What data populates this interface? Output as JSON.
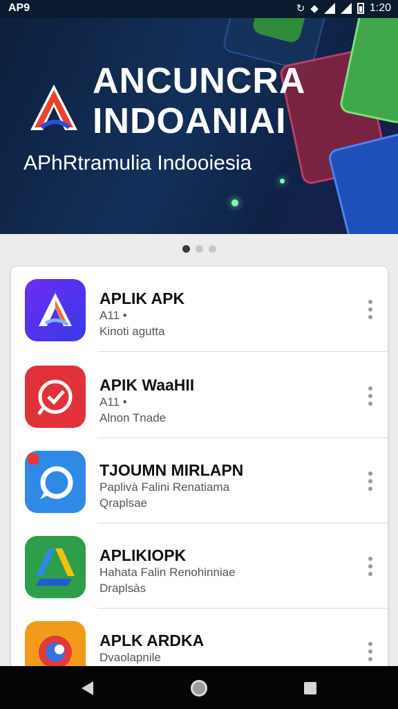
{
  "status_bar": {
    "carrier": "AP9",
    "time": "1:20"
  },
  "banner": {
    "title_line1": "ANCUNCRA",
    "title_line2": "INDOANIAI",
    "subtitle": "APhRtramulia Indooiesia"
  },
  "carousel": {
    "total": 3,
    "active": 1
  },
  "apps": [
    {
      "name": "APLIK APK",
      "line1": "A11 •",
      "line2": "Kinoti agutta",
      "icon": "a-logo-icon",
      "color": "#5a2be0"
    },
    {
      "name": "APIK WaaHII",
      "line1": "A11 •",
      "line2": "Alnon Tnade",
      "icon": "check-badge-icon",
      "color": "#e0343c"
    },
    {
      "name": "TJOUMN MIRLAPN",
      "line1": "Paplivà Falini Renatiama",
      "line2": "Qraplsae",
      "icon": "chat-ring-icon",
      "color": "#2f8ae6"
    },
    {
      "name": "APLIKIOPK",
      "line1": "Hahata Falin Renohinniae",
      "line2": "Draplsàs",
      "icon": "drive-triangle-icon",
      "color": "#2e9e4a"
    },
    {
      "name": "APLK ARDKA",
      "line1": "Dvaolapnile",
      "line2": "",
      "icon": "orange-swirl-icon",
      "color": "#f29a1c"
    }
  ],
  "navigation": {
    "back": "back-icon",
    "home": "home-icon",
    "recents": "recents-icon"
  }
}
